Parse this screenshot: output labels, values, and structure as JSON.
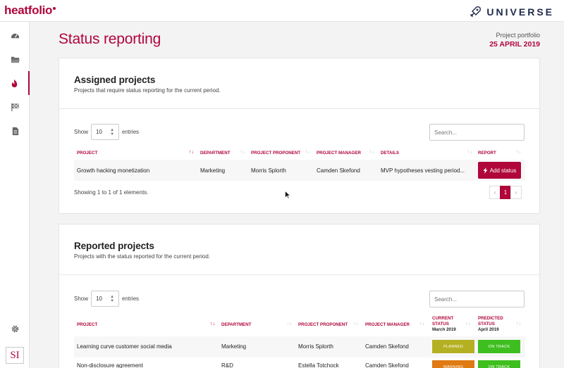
{
  "app": {
    "logo": "heatfolio",
    "brand": "UNIVERSE"
  },
  "sidebar": {
    "items": [
      {
        "icon": "dashboard-icon"
      },
      {
        "icon": "folder-icon"
      },
      {
        "icon": "flame-icon",
        "active": true
      },
      {
        "icon": "checkered-flag-icon"
      },
      {
        "icon": "document-icon"
      }
    ],
    "settings_icon": "gear-icon",
    "badge": "SI"
  },
  "header": {
    "title": "Status reporting",
    "portfolio_label": "Project portfolio",
    "date": "25 APRIL 2019"
  },
  "assigned": {
    "title": "Assigned projects",
    "subtitle": "Projects that require status reporting for the current period.",
    "show_label": "Show",
    "entries_value": "10",
    "entries_label": "entries",
    "search_placeholder": "Search...",
    "columns": [
      "PROJECT",
      "DEPARTMENT",
      "PROJECT PROPONENT",
      "PROJECT MANAGER",
      "DETAILS",
      "REPORT"
    ],
    "rows": [
      {
        "project": "Growth hacking monetization",
        "department": "Marketing",
        "proponent": "Morris Splorth",
        "manager": "Camden Skefond",
        "details": "MVP hypotheses vesting period...",
        "action": "Add status"
      }
    ],
    "info": "Showing 1 to 1 of 1 elements.",
    "pager": {
      "prev": "‹",
      "page": "1",
      "next": "›"
    }
  },
  "reported": {
    "title": "Reported projects",
    "subtitle": "Projects with the status reported for the current period.",
    "show_label": "Show",
    "entries_value": "10",
    "entries_label": "entries",
    "search_placeholder": "Search...",
    "columns": {
      "project": "PROJECT",
      "department": "DEPARTMENT",
      "proponent": "PROJECT PROPONENT",
      "manager": "PROJECT MANAGER",
      "current": "CURRENT STATUS",
      "current_sub": "March 2019",
      "predicted": "PREDICTED STATUS",
      "predicted_sub": "April 2019"
    },
    "rows": [
      {
        "project": "Learning curve customer social media",
        "department": "Marketing",
        "proponent": "Morris Splorth",
        "manager": "Camden Skefond",
        "current": "PLANNED",
        "current_color": "#b5b021",
        "predicted": "ON TRACK",
        "predicted_color": "#3fbf1f"
      },
      {
        "project": "Non-disclosure agreement",
        "department": "R&D",
        "proponent": "Estella Totchock",
        "manager": "Camden Skefond",
        "current": "WARNING",
        "current_color": "#e07a12",
        "predicted": "ON TRACK",
        "predicted_color": "#3fbf1f"
      }
    ]
  },
  "colors": {
    "accent": "#b0063a",
    "navy": "#1f2a4a"
  }
}
